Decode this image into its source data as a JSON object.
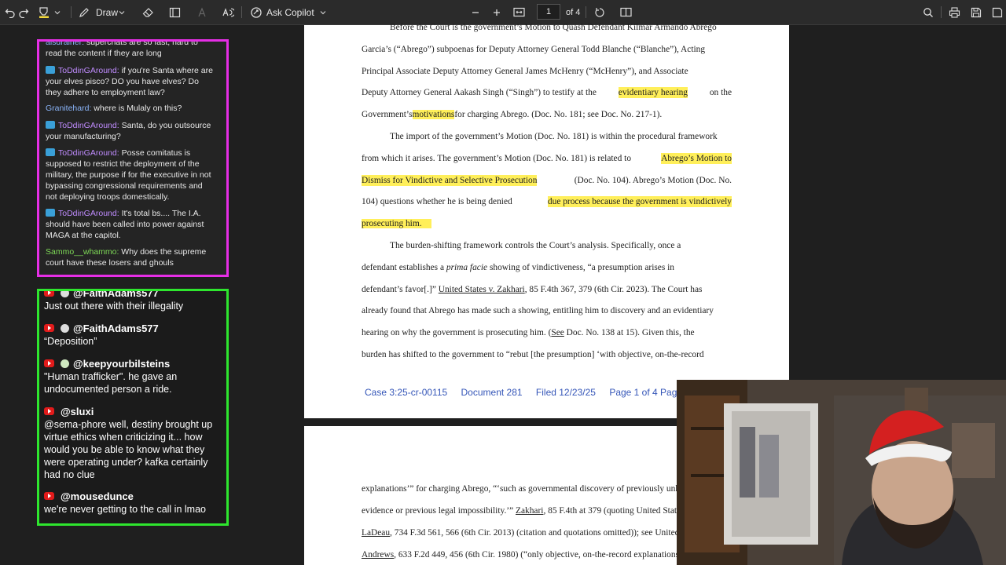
{
  "toolbar": {
    "draw_label": "Draw",
    "copilot_label": "Ask Copilot",
    "page_number": "1",
    "page_total": "of 4"
  },
  "document": {
    "lines": [
      "Before the Court is the government’s Motion to Quash Defendant Kilmar Armando Abrego",
      "Garcia’s (“Abrego”) subpoenas for Deputy Attorney General Todd Blanche (“Blanche”), Acting",
      "Principal Associate Deputy Attorney General James McHenry (“McHenry”), and Associate"
    ],
    "line4_pre": "Deputy Attorney General Aakash Singh (“Singh”) to testify at the",
    "line4_hl": "evidentiary hearing",
    "line4_post": "on the",
    "line5_pre": "Government’s",
    "line5_hl": "motivations",
    "line5_post": "for charging Abrego.  (Doc. No. 181; see Doc. No. 217-1).",
    "line6": "The import of the government’s Motion (Doc. No. 181) is within the procedural framework",
    "line7_pre": "from which it arises.  The government’s Motion (Doc. No. 181) is related to",
    "line7_hl": "Abrego’s Motion to",
    "line8_hl": "Dismiss for Vindictive and Selective Prosecution",
    "line8_post": "(Doc. No. 104).  Abrego’s Motion (Doc. No.",
    "line9_pre": "104) questions whether he is being denied",
    "line9_hl": "due process because the government is vindictively",
    "line10_hl": "prosecuting him.",
    "line11": "The burden-shifting framework controls the Court’s analysis.   Specifically, once a",
    "line12_pre": "defendant establishes a",
    "line12_it": "prima facie",
    "line12_post": "showing of vindictiveness, “a presumption arises in",
    "line13_pre": "defendant’s favor[.]”",
    "line13_ul": "United States v. Zakhari",
    "line13_post": ", 85 F.4th 367, 379 (6th Cir. 2023).  The Court has",
    "line14": "already found that Abrego has made such a showing, entitling him to discovery and an evidentiary",
    "line15_pre": "hearing on why the government is prosecuting him.  (",
    "line15_ul": "See",
    "line15_post": " Doc. No. 138 at 15).  Given this, the",
    "line16": "burden has shifted to the government to “rebut [the presumption] ‘with objective, on-the-record",
    "footer": [
      "Case 3:25-cr-00115",
      "Document 281",
      "Filed 12/23/25",
      "Page 1 of 4 PageID"
    ],
    "page2": {
      "line1": "explanations’” for charging Abrego, “‘such as governmental discovery of previously unknown",
      "line2_pre": "evidence or previous legal impossibility.’”  ",
      "line2_ul": "Zakhari",
      "line2_post": ", 85 F.4th at 379 (quoting United States v.",
      "line3_ul": "LaDeau",
      "line3_post": ", 734 F.3d 561, 566 (6th Cir. 2013) (citation and quotations omitted)); see United States v.",
      "line4_ul": "Andrews",
      "line4_post": ", 633 F.2d 449, 456 (6th Cir. 1980) (“only objective, on-the-record explanations"
    }
  },
  "chat_twitch": {
    "top_fragment_name": "aisdrainer:",
    "top_fragment_text": "superchats are so fast, hard to read the content if they are long",
    "messages": [
      {
        "user": "ToDdinGAround:",
        "text": "if you're Santa where are your elves pisco? DO you have elves? Do they adhere to employment law?"
      },
      {
        "user": "Granitehard:",
        "text": "where is Mulaly on this?"
      },
      {
        "user": "ToDdinGAround:",
        "text": "Santa, do you outsource your manufacturing?"
      },
      {
        "user": "ToDdinGAround:",
        "text": "Posse comitatus is supposed to restrict the deployment of the military, the purpose if for the executive in not bypassing congressional requirements and not deploying troops domestically."
      },
      {
        "user": "ToDdinGAround:",
        "text": "It's total bs.... The I.A. should have been called into power against MAGA at the capitol."
      },
      {
        "user": "Sammo__whammo:",
        "text": "Why does the supreme court have these losers and ghouls"
      }
    ]
  },
  "chat_youtube": {
    "messages": [
      {
        "user": "@FaithAdams577",
        "text": "Just out there with their illegality"
      },
      {
        "user": "@FaithAdams577",
        "text": "“Deposition”"
      },
      {
        "user": "@keepyourbilsteins",
        "text": "\"Human trafficker\". he gave an undocumented person a ride."
      },
      {
        "user": "@sluxi",
        "text": "@sema-phore well, destiny brought up virtue ethics when criticizing it... how would you be able to know what they were operating under? kafka certainly had no clue"
      },
      {
        "user": "@mousedunce",
        "text": "we're never getting to the call in lmao"
      }
    ]
  }
}
